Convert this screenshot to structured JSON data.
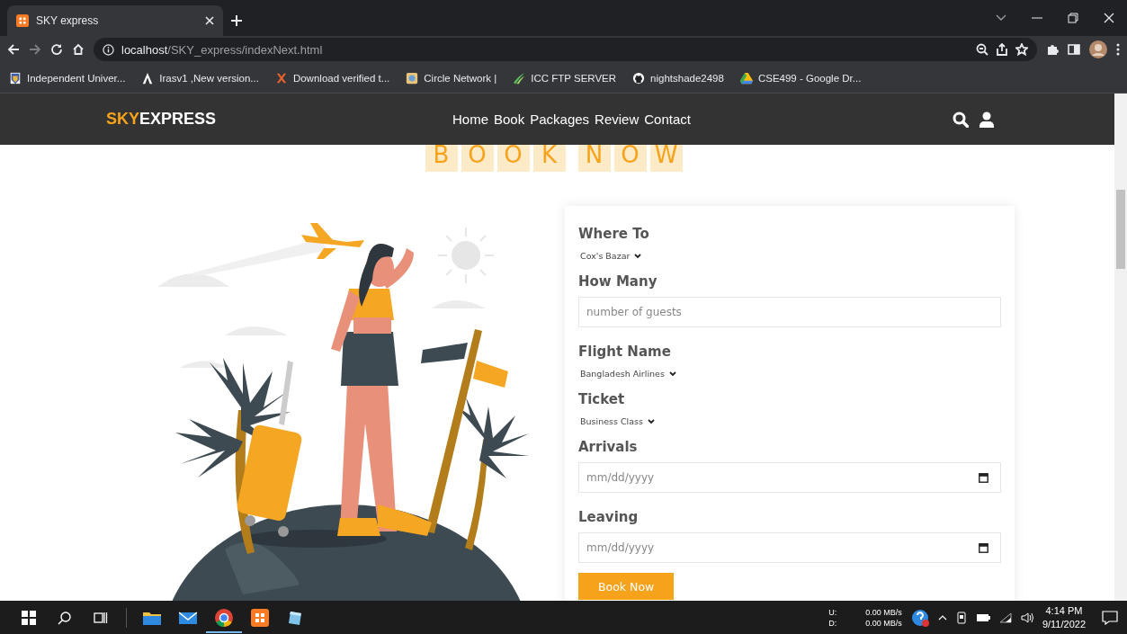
{
  "browser": {
    "tab_title": "SKY express",
    "address": {
      "host": "localhost",
      "path": "/SKY_express/indexNext.html"
    },
    "bookmarks": [
      {
        "label": "Independent Univer..."
      },
      {
        "label": "Irasv1 ,New version..."
      },
      {
        "label": "Download verified t..."
      },
      {
        "label": "Circle Network |"
      },
      {
        "label": "ICC FTP SERVER"
      },
      {
        "label": "nightshade2498"
      },
      {
        "label": "CSE499 - Google Dr..."
      }
    ]
  },
  "site": {
    "logo": {
      "accent": "SKY",
      "rest": "EXPRESS"
    },
    "nav": [
      "Home",
      "Book",
      "Packages",
      "Review",
      "Contact"
    ]
  },
  "heading": {
    "words": [
      [
        "B",
        "O",
        "O",
        "K"
      ],
      [
        "N",
        "O",
        "W"
      ]
    ]
  },
  "form": {
    "fields": [
      {
        "kind": "select",
        "label": "Where To",
        "value": "Cox's Bazar"
      },
      {
        "kind": "text",
        "label": "How Many",
        "placeholder": "number of guests"
      },
      {
        "kind": "select",
        "label": "Flight Name",
        "value": "Bangladesh Airlines"
      },
      {
        "kind": "select",
        "label": "Ticket",
        "value": "Business Class"
      },
      {
        "kind": "date",
        "label": "Arrivals",
        "placeholder": "mm/dd/yyyy"
      },
      {
        "kind": "date",
        "label": "Leaving",
        "placeholder": "mm/dd/yyyy"
      }
    ],
    "submit": "Book Now"
  },
  "taskbar": {
    "upload_label": "U:",
    "download_label": "D:",
    "upload_speed": "0.00 MB/s",
    "download_speed": "0.00 MB/s",
    "time": "4:14 PM",
    "date": "9/11/2022"
  }
}
